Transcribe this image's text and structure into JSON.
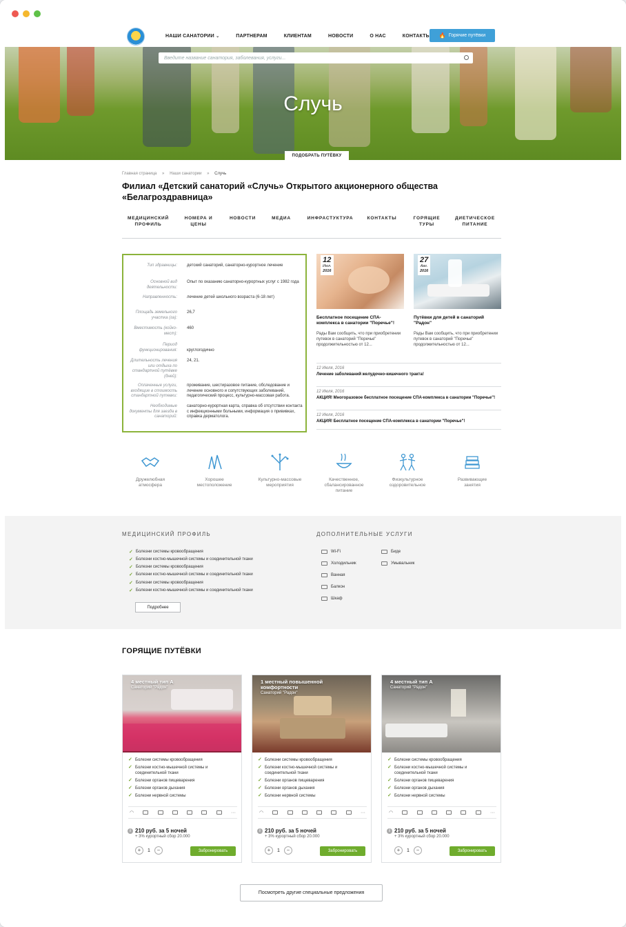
{
  "colors": {
    "accent_green": "#8bb33a",
    "hot_button": "#3fa0d8",
    "book_button": "#6fac2d",
    "check": "#7aa733"
  },
  "window": {
    "dots": [
      "#ee5a52",
      "#f5b82e",
      "#5fc148"
    ]
  },
  "nav": {
    "items": [
      "НАШИ САНАТОРИИ",
      "ПАРТНЕРАМ",
      "КЛИЕНТАМ",
      "НОВОСТИ",
      "О НАС",
      "КОНТАКТЫ"
    ],
    "hot_label": "Горячие путёвки",
    "dropdown_icon": "chevron-down-icon"
  },
  "hero": {
    "search_placeholder": "Введите название санатория, заболевания, услуги...",
    "title": "Случь",
    "pick_button": "ПОДОБРАТЬ ПУТЁВКУ"
  },
  "breadcrumb": [
    "Главная страница",
    "»",
    "Наши санатории",
    "»",
    "Случь"
  ],
  "page_title": "Филиал «Детский санаторий «Случь» Открытого акционерного общества «Белагроздравница»",
  "tabs": [
    {
      "l1": "МЕДИЦИНСКИЙ",
      "l2": "ПРОФИЛЬ"
    },
    {
      "l1": "НОМЕРА И",
      "l2": "ЦЕНЫ"
    },
    {
      "l1": "НОВОСТИ",
      "l2": ""
    },
    {
      "l1": "МЕДИА",
      "l2": ""
    },
    {
      "l1": "ИНФРАСТУКТУРА",
      "l2": ""
    },
    {
      "l1": "КОНТАКТЫ",
      "l2": ""
    },
    {
      "l1": "ГОРЯЩИЕ",
      "l2": "ТУРЫ"
    },
    {
      "l1": "ДИЕТИЧЕСКОЕ",
      "l2": "ПИТАНИЕ"
    }
  ],
  "info": [
    {
      "k": "Тип здравницы:",
      "v": "детский санаторий, санаторно-курортное лечение"
    },
    {
      "k": "Основной вид деятельности:",
      "v": "Опыт по оказанию санаторно-курортных услуг с 1982 года"
    },
    {
      "k": "Направленность:",
      "v": "лечение детей школьного возраста (6-18 лет)"
    },
    {
      "k": "Площадь земельного участка (га):",
      "v": "26,7"
    },
    {
      "k": "Вместимость (койко-мест):",
      "v": "460"
    },
    {
      "k": "Период функционирования:",
      "v": "круглогодично"
    },
    {
      "k": "Длительность лечения или отдыха по стандартной путёвке (дней):",
      "v": "24, 21."
    },
    {
      "k": "Оплаченные услуги, входящие в стоимость стандартной путевки:",
      "v": "проживание, шестиразовое питание, обследование и лечение основного и сопутствующих заболеваний, педагогический процесс, культурно-массовая работа."
    },
    {
      "k": "Необходимые документы для заезда в санаторий:",
      "v": "санаторно-курортная карта, справка об отсутствии контакта с инфекционными больными, информация о прививках, справка дерматолога."
    }
  ],
  "news_cards": [
    {
      "day": "12",
      "month": "Июл.",
      "year": "2016",
      "title": "Бесплатное посещение СПА-комплекса в санатории \"Поречье\"!",
      "text": "Рады Вам сообщить, что при приобретении путевок в санаторий \"Поречье\" продолжительностью от 12..."
    },
    {
      "day": "27",
      "month": "Авг.",
      "year": "2016",
      "title": "Путёвки для детей в санаторий \"Радон\"",
      "text": "Рады Вам сообщить, что при приобретении путевок в санаторий \"Поречье\" продолжительностью от 12..."
    }
  ],
  "news_lines": [
    {
      "date": "12 Июля, 2016",
      "title": "Лечение заболеваний желудочно-кишечного тракта!"
    },
    {
      "date": "12 Июля, 2016",
      "title": "АКЦИЯ! Многоразовое бесплатное посещение СПА-комплекса в санатории \"Поречье\"!"
    },
    {
      "date": "12 Июля, 2016",
      "title": "АКЦИЯ! Бесплатное посещение СПА-комплекса в санатории \"Поречье\"!"
    }
  ],
  "features": [
    {
      "icon": "handshake-icon",
      "l1": "Дружелюбная",
      "l2": "атмосфера",
      "l3": ""
    },
    {
      "icon": "trees-icon",
      "l1": "Хорошее",
      "l2": "местоположение",
      "l3": ""
    },
    {
      "icon": "tree-icon",
      "l1": "Культурно-массовые",
      "l2": "мероприятия",
      "l3": ""
    },
    {
      "icon": "bowl-icon",
      "l1": "Качественное,",
      "l2": "сбалансированное",
      "l3": "питание"
    },
    {
      "icon": "athletes-icon",
      "l1": "Физкультурное",
      "l2": "оздоровительное",
      "l3": ""
    },
    {
      "icon": "books-icon",
      "l1": "Развивающие",
      "l2": "занятия",
      "l3": ""
    }
  ],
  "medical": {
    "heading": "МЕДИЦИНСКИЙ ПРОФИЛЬ",
    "items": [
      "Болезни системы кровообращения",
      "Болезни костно-мышечной системы и соединительной ткани",
      "Болезни системы кровообращения",
      "Болезни костно-мышечной системы и соединительной ткани",
      "Болезни системы кровообращения",
      "Болезни костно-мышечной системы и соединительной ткани"
    ],
    "more": "Подробнее"
  },
  "services": {
    "heading": "ДОПОЛНИТЕЛЬНЫЕ УСЛУГИ",
    "col1": [
      "Wi-Fi",
      "Холодильник",
      "Ванная",
      "Балкон",
      "Шкаф"
    ],
    "col2": [
      "Биде",
      "Умывальник"
    ]
  },
  "hot": {
    "heading": "ГОРЯЩИЕ ПУТЁВКИ",
    "cards": [
      {
        "name": "4 местный тип А",
        "sanatorium": "Санаторий \"Радон\"",
        "items": [
          "Болезни системы кровообращения",
          "Болезни костно-мышечной системы и соединительной ткани",
          "Болезни органов пищеварения",
          "Болезни органов дыхания",
          "Болезни нервной системы"
        ],
        "price": "210 руб. за 5 ночей",
        "tax": "+ 3% курортный сбор 20.000",
        "qty": "1",
        "book": "Забронировать"
      },
      {
        "name": "1 местный повышенной комфортности",
        "sanatorium": "Санаторий \"Радон\"",
        "items": [
          "Болезни системы кровообращения",
          "Болезни костно-мышечной системы и соединительной ткани",
          "Болезни органов пищеварения",
          "Болезни органов дыхания",
          "Болезни нервной системы"
        ],
        "price": "210 руб. за 5 ночей",
        "tax": "+ 3% курортный сбор 20.000",
        "qty": "1",
        "book": "Забронировать"
      },
      {
        "name": "4 местный тип А",
        "sanatorium": "Санаторий \"Радон\"",
        "items": [
          "Болезни системы кровообращения",
          "Болезни костно-мышечной системы и соединительной ткани",
          "Болезни органов пищеварения",
          "Болезни органов дыхания",
          "Болезни нервной системы"
        ],
        "price": "210 руб. за 5 ночей",
        "tax": "+ 3% курортный сбор 20.000",
        "qty": "1",
        "book": "Забронировать"
      }
    ],
    "all_button": "Посмотреть другие специальные предложения"
  }
}
